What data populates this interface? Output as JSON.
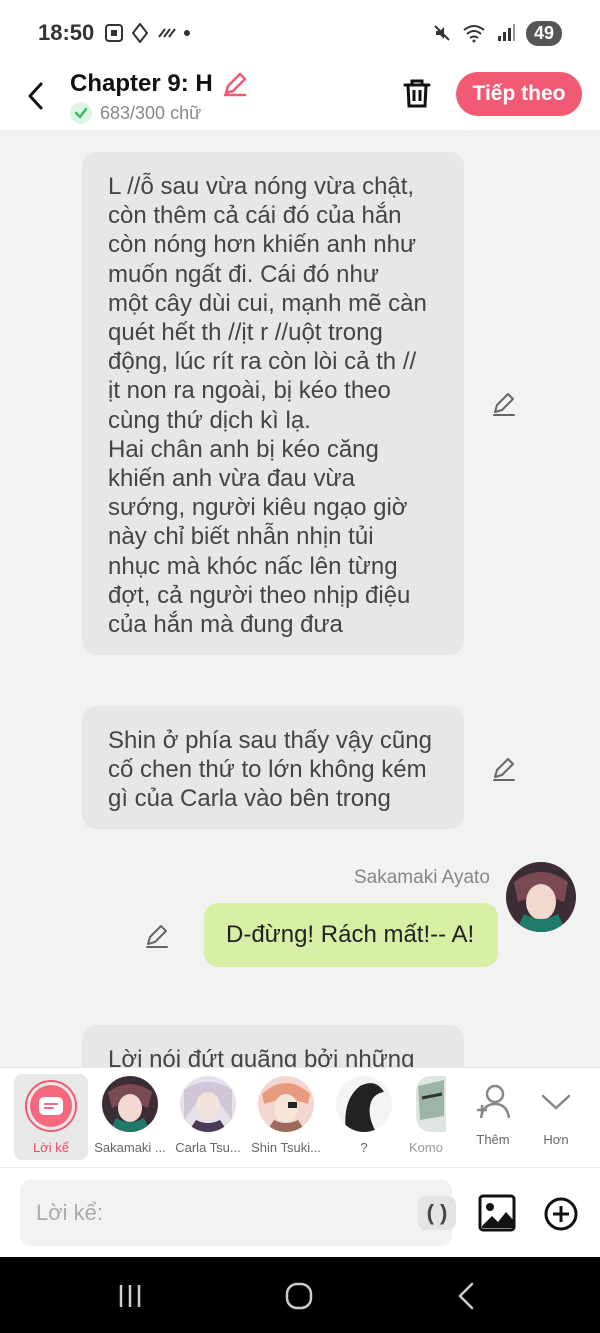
{
  "status": {
    "time": "18:50",
    "battery": "49"
  },
  "header": {
    "title": "Chapter 9: H",
    "word_count": "683/300 chữ",
    "next_label": "Tiếp theo"
  },
  "messages": [
    {
      "type": "narration",
      "text": "L //ỗ sau vừa nóng vừa chật,\ncòn thêm cả cái đó của hắn\ncòn nóng hơn khiến anh như\nmuốn ngất đi. Cái đó như\nmột cây dùi cui, mạnh mẽ càn\nquét hết th //ịt r //uột trong\nđộng, lúc rít ra còn lòi cả th //\nịt non ra ngoài, bị kéo theo\ncùng thứ dịch kì lạ.\nHai chân anh bị kéo căng\nkhiến anh vừa đau vừa\nsướng, người kiêu ngạo giờ\nnày chỉ biết nhẫn nhịn tủi\nnhục mà khóc nấc lên từng\nđợt, cả người theo nhịp điệu\ncủa hắn mà đung đưa"
    },
    {
      "type": "narration",
      "text": "Shin ở phía sau thấy vậy cũng\ncố chen thứ to lớn không kém\ngì của Carla vào bên trong"
    },
    {
      "type": "character",
      "sender": "Sakamaki Ayato",
      "text": "D-đừng! Rách mất!-- A!"
    },
    {
      "type": "narration",
      "text": "Lời nói đứt quãng bởi những"
    }
  ],
  "characters": [
    {
      "label": "Lời kể"
    },
    {
      "label": "Sakamaki ..."
    },
    {
      "label": "Carla Tsu..."
    },
    {
      "label": "Shin Tsuki..."
    },
    {
      "label": "?"
    },
    {
      "label": "Komo"
    }
  ],
  "actions": {
    "add_label": "Thêm",
    "more_label": "Hơn"
  },
  "input": {
    "placeholder": "Lời kể:",
    "paren": "( )"
  },
  "colors": {
    "accent": "#f25a74",
    "bubble_gray": "#e7e7e7",
    "bubble_green": "#d7f0a5"
  }
}
